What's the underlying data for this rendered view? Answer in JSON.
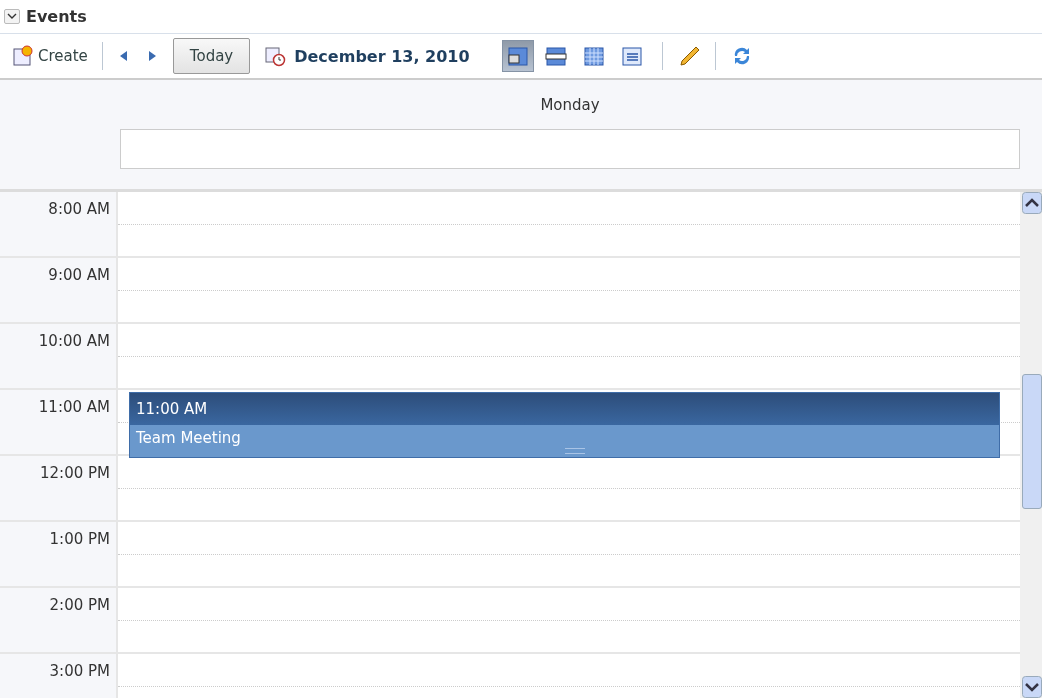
{
  "panel": {
    "title": "Events",
    "expanded": true
  },
  "toolbar": {
    "create": "Create",
    "today": "Today",
    "date": "December 13, 2010",
    "views": [
      {
        "kind": "day",
        "selected": true
      },
      {
        "kind": "week",
        "selected": false
      },
      {
        "kind": "month",
        "selected": false
      },
      {
        "kind": "list",
        "selected": false
      }
    ]
  },
  "day_header": {
    "day": "Monday"
  },
  "hours": [
    {
      "label": "8:00 AM"
    },
    {
      "label": "9:00 AM"
    },
    {
      "label": "10:00 AM"
    },
    {
      "label": "11:00 AM",
      "events": [
        {
          "time": "11:00 AM",
          "title": "Team Meeting"
        }
      ]
    },
    {
      "label": "12:00 PM"
    },
    {
      "label": "1:00 PM"
    },
    {
      "label": "2:00 PM"
    },
    {
      "label": "3:00 PM"
    }
  ]
}
